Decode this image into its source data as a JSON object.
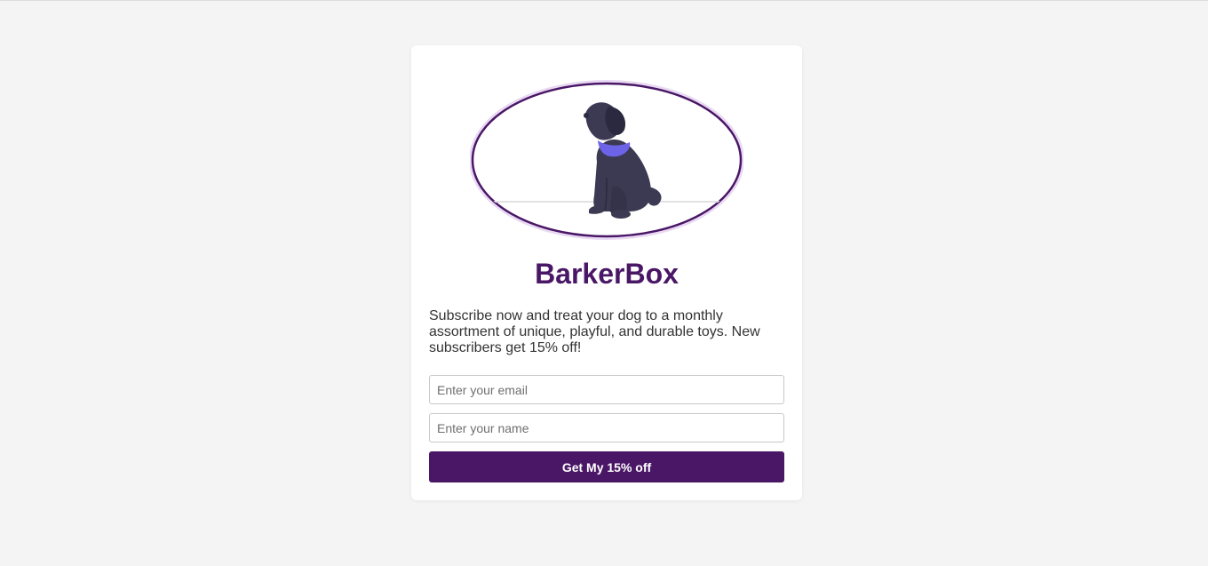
{
  "brand": {
    "title": "BarkerBox",
    "accent_color": "#4a1766"
  },
  "hero": {
    "icon": "dog-illustration-icon"
  },
  "description": "Subscribe now and treat your dog to a monthly assortment of unique, playful, and durable toys. New subscribers get 15% off!",
  "form": {
    "email_placeholder": "Enter your email",
    "email_value": "",
    "name_placeholder": "Enter your name",
    "name_value": "",
    "submit_label": "Get My 15% off"
  }
}
